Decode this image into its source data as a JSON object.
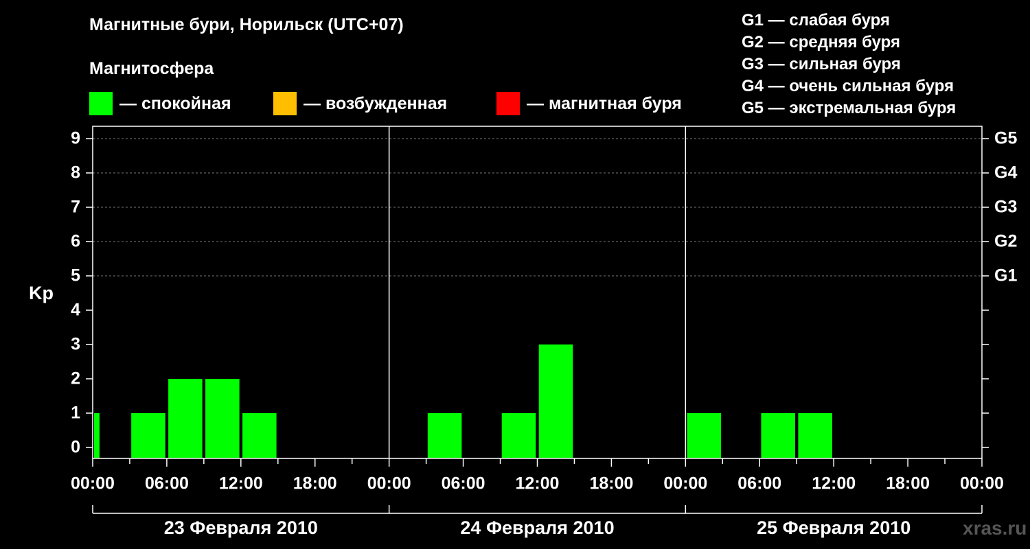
{
  "title": "Магнитные бури, Норильск (UTC+07)",
  "magnetosphere_label": "Магнитосфера",
  "legend": [
    {
      "label": "— спокойная",
      "color": "#00ff00"
    },
    {
      "label": "— возбужденная",
      "color": "#ffbf00"
    },
    {
      "label": "— магнитная буря",
      "color": "#ff0000"
    }
  ],
  "g_legend": [
    "G1 — слабая буря",
    "G2 — средняя буря",
    "G3 — сильная буря",
    "G4 — очень сильная буря",
    "G5 — экстремальная буря"
  ],
  "watermark": "xras.ru",
  "chart_data": {
    "type": "bar",
    "ylabel": "Kp",
    "ylim": [
      0,
      9
    ],
    "yticks": [
      "0",
      "1",
      "2",
      "3",
      "4",
      "5",
      "6",
      "7",
      "8",
      "9"
    ],
    "right_axis_labels": [
      {
        "kp": 5,
        "label": "G1"
      },
      {
        "kp": 6,
        "label": "G2"
      },
      {
        "kp": 7,
        "label": "G3"
      },
      {
        "kp": 8,
        "label": "G4"
      },
      {
        "kp": 9,
        "label": "G5"
      }
    ],
    "grid": "dashed horizontal at Kp 5–9",
    "xtick_labels": [
      "00:00",
      "06:00",
      "12:00",
      "18:00",
      "00:00",
      "06:00",
      "12:00",
      "18:00",
      "00:00",
      "06:00",
      "12:00",
      "18:00",
      "00:00"
    ],
    "days": [
      "23 Февраля 2010",
      "24 Февраля 2010",
      "25 Февраля 2010"
    ],
    "interval_hours": 3,
    "series": [
      {
        "values": [
          1,
          1,
          2,
          2,
          1,
          0,
          0,
          0,
          0,
          1,
          0,
          1,
          3,
          0,
          0,
          0,
          1,
          0,
          1,
          1,
          0,
          0,
          0,
          0
        ]
      }
    ],
    "first_interval_note": "partial",
    "bar_color": "#00ff00"
  }
}
